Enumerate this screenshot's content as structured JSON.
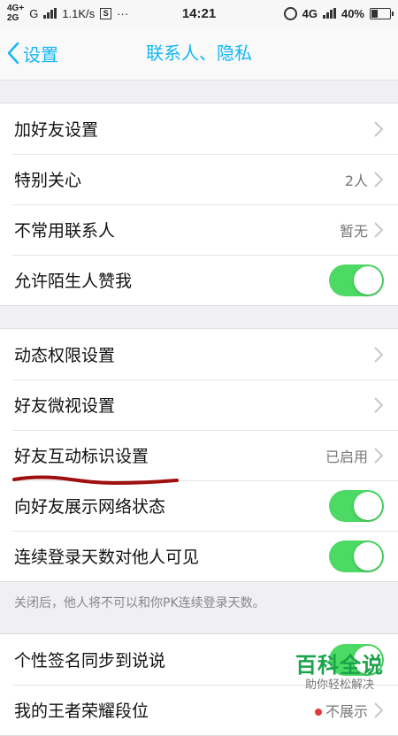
{
  "status_bar": {
    "net_top": "4G+",
    "net_bottom": "2G",
    "carrier": "G",
    "speed": "1.1K/s",
    "sim_icon_text": "S",
    "dots": "···",
    "time": "14:21",
    "net_right": "4G",
    "battery": "40%",
    "battery_level": 0.4
  },
  "nav": {
    "back_label": "设置",
    "title": "联系人、隐私"
  },
  "group1": [
    {
      "label": "加好友设置",
      "type": "chevron"
    },
    {
      "label": "特别关心",
      "value": "2人",
      "type": "chevron"
    },
    {
      "label": "不常用联系人",
      "value": "暂无",
      "type": "chevron"
    },
    {
      "label": "允许陌生人赞我",
      "type": "toggle",
      "on": true
    }
  ],
  "group2": [
    {
      "label": "动态权限设置",
      "type": "chevron"
    },
    {
      "label": "好友微视设置",
      "type": "chevron"
    },
    {
      "label": "好友互动标识设置",
      "value": "已启用",
      "type": "chevron"
    },
    {
      "label": "向好友展示网络状态",
      "type": "toggle",
      "on": true
    },
    {
      "label": "连续登录天数对他人可见",
      "type": "toggle",
      "on": true
    }
  ],
  "group2_note": "关闭后，他人将不可以和你PK连续登录天数。",
  "group3": [
    {
      "label": "个性签名同步到说说",
      "type": "toggle",
      "on": true
    },
    {
      "label": "我的王者荣耀段位",
      "value": "不展示",
      "type": "chevron"
    }
  ],
  "watermark": {
    "main": "百科全说",
    "sub": "助你轻松解决"
  },
  "colors": {
    "accent": "#12b7f5",
    "toggle_on": "#4cd964",
    "annotation": "#a01010",
    "watermark": "#1aa34a"
  }
}
